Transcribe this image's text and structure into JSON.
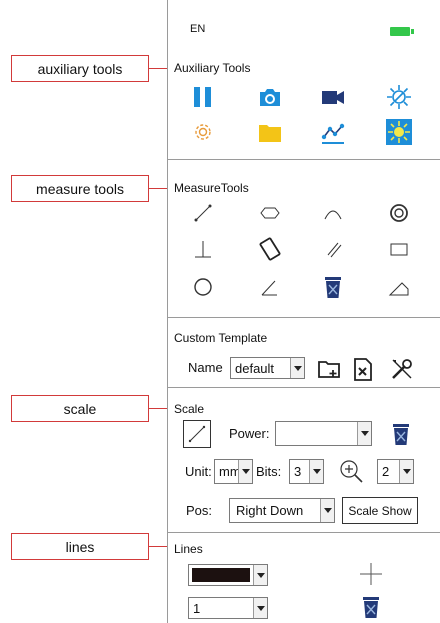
{
  "callouts": {
    "auxiliary": "auxiliary tools",
    "measure": "measure tools",
    "scale": "scale",
    "lines": "lines"
  },
  "header": {
    "language": "EN",
    "battery_color": "#33c74a"
  },
  "auxiliary": {
    "title": "Auxiliary Tools",
    "tools": [
      "pause-icon",
      "camera-icon",
      "video-record-icon",
      "brightness-icon",
      "settings-gear-icon",
      "folder-icon",
      "curve-graph-icon",
      "auto-exposure-icon"
    ]
  },
  "measure": {
    "title": "MeasureTools",
    "tools": [
      "line-tool-icon",
      "polygon-tool-icon",
      "arc-tool-icon",
      "concentric-circle-tool-icon",
      "perpendicular-tool-icon",
      "parallel-lines-tool-icon",
      "parallel-lines-diagonal-tool-icon",
      "rectangle-tool-icon",
      "circle-tool-icon",
      "angle-tool-icon",
      "delete-icon",
      "polyline-tool-icon"
    ]
  },
  "template": {
    "title": "Custom Template",
    "name_label": "Name",
    "name_value": "default"
  },
  "scale": {
    "title": "Scale",
    "power_label": "Power:",
    "power_value": "",
    "unit_label": "Unit:",
    "unit_value": "mm",
    "bits_label": "Bits:",
    "bits_value": "3",
    "zoom_value": "2",
    "pos_label": "Pos:",
    "pos_value": "Right Down",
    "scale_show_label": "Scale Show"
  },
  "lines": {
    "title": "Lines",
    "color_value": "#1c1110",
    "width_value": "1"
  },
  "colors": {
    "accent_blue": "#1e8ed8",
    "navy": "#233a78",
    "annotation_red": "#d23a3a",
    "folder_yellow": "#f3c417"
  }
}
